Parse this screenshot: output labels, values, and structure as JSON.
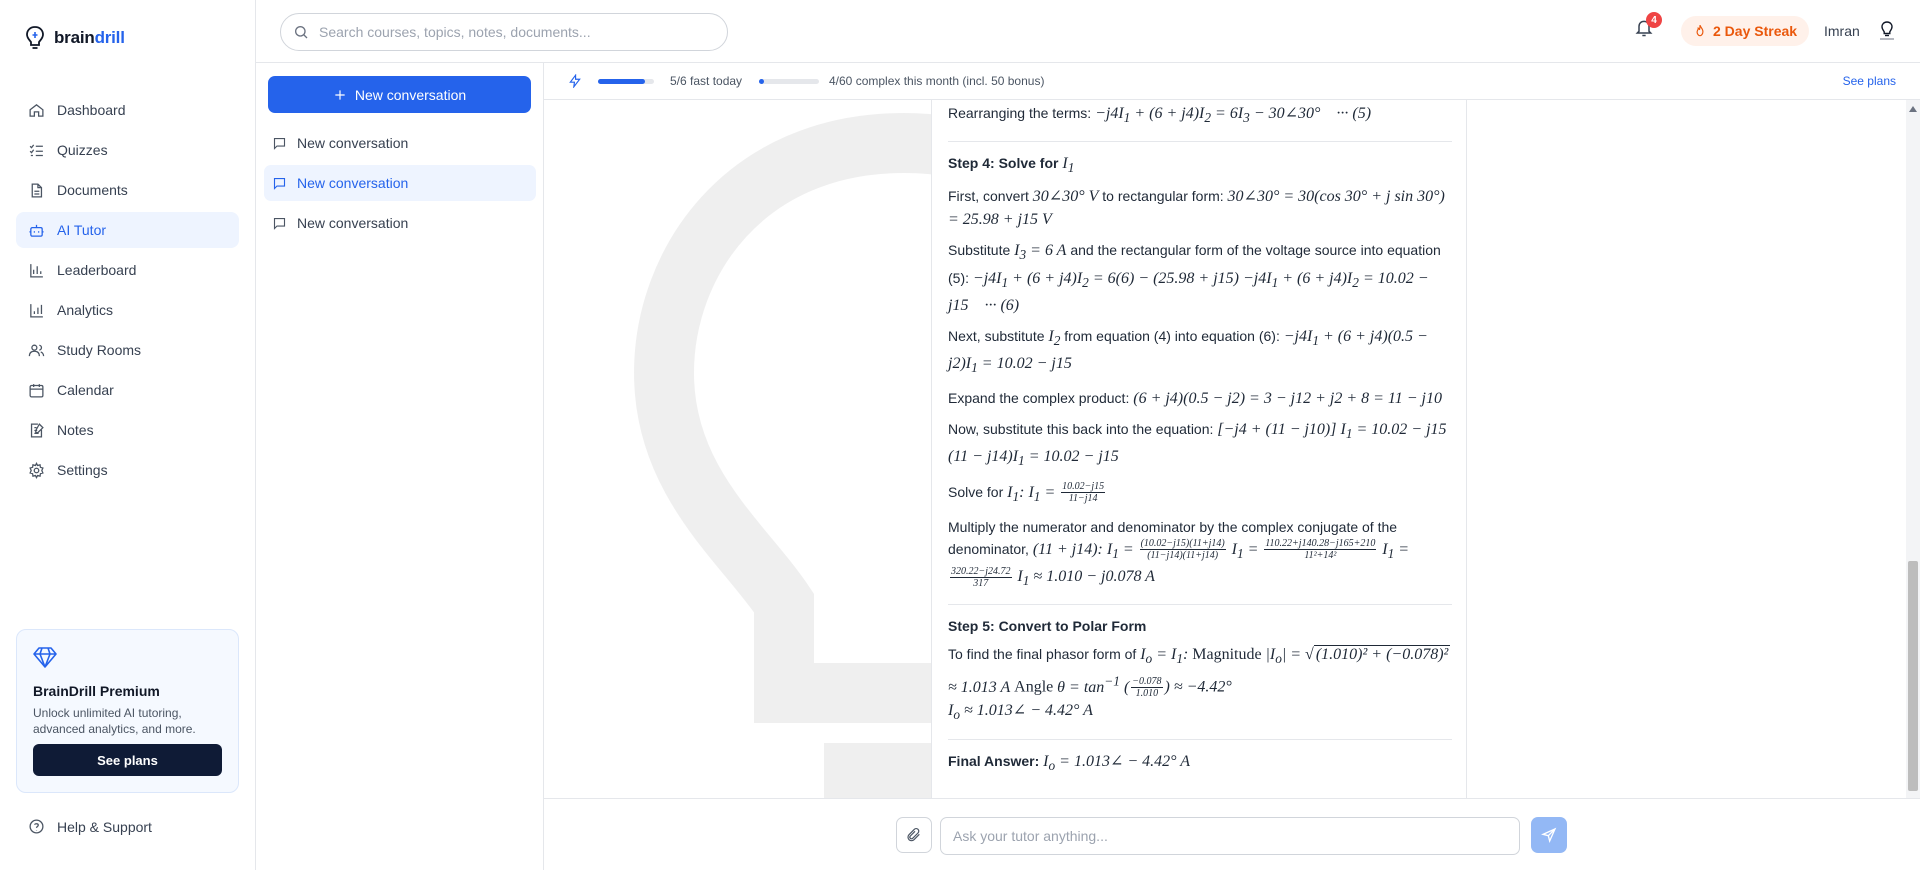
{
  "brand": {
    "name_part1": "brain",
    "name_part2": "drill"
  },
  "search": {
    "placeholder": "Search courses, topics, notes, documents..."
  },
  "header": {
    "notifications_count": "4",
    "streak_label": "2 Day Streak",
    "user_name": "Imran"
  },
  "sidebar": {
    "items": [
      {
        "label": "Dashboard",
        "icon": "home-icon"
      },
      {
        "label": "Quizzes",
        "icon": "list-check-icon"
      },
      {
        "label": "Documents",
        "icon": "document-icon"
      },
      {
        "label": "AI Tutor",
        "icon": "bot-icon",
        "active": true
      },
      {
        "label": "Leaderboard",
        "icon": "bar-chart-icon"
      },
      {
        "label": "Analytics",
        "icon": "analytics-icon"
      },
      {
        "label": "Study Rooms",
        "icon": "users-icon"
      },
      {
        "label": "Calendar",
        "icon": "calendar-icon"
      },
      {
        "label": "Notes",
        "icon": "notes-icon"
      },
      {
        "label": "Settings",
        "icon": "gear-icon"
      }
    ],
    "premium": {
      "title": "BrainDrill Premium",
      "description": "Unlock unlimited AI tutoring, advanced analytics, and more.",
      "button_label": "See plans"
    },
    "help_label": "Help & Support"
  },
  "conversations": {
    "new_button_label": "New conversation",
    "items": [
      {
        "label": "New conversation",
        "active": false
      },
      {
        "label": "New conversation",
        "active": true
      },
      {
        "label": "New conversation",
        "active": false
      }
    ]
  },
  "usage": {
    "fast_label": "5/6 fast today",
    "fast_fraction": 0.833,
    "complex_label": "4/60 complex this month (incl. 50 bonus)",
    "complex_fraction": 0.067,
    "see_plans_label": "See plans"
  },
  "message": {
    "rearrange_prefix": "Rearranging the terms:",
    "step4_title": "Step 4: Solve for",
    "step4_p1_prefix": "First, convert",
    "step4_p1_mid": "to rectangular form:",
    "step4_p2_prefix": "Substitute",
    "step4_p2_mid": "and the rectangular form of the voltage source into equation (5):",
    "step4_p3_prefix": "Next, substitute",
    "step4_p3_mid": "from equation (4) into equation (6):",
    "step4_p4_prefix": "Expand the complex product:",
    "step4_p5_prefix": "Now, substitute this back into the equation:",
    "step4_p6_prefix": "Solve for",
    "step4_p7_prefix": "Multiply the numerator and denominator by the complex conjugate of the denominator,",
    "step5_title": "Step 5: Convert to Polar Form",
    "step5_p1_prefix": "To find the final phasor form of",
    "step5_magnitude": "Magnitude",
    "step5_angle": "Angle",
    "final_label": "Final Answer:"
  },
  "composer": {
    "placeholder": "Ask your tutor anything..."
  },
  "colors": {
    "accent": "#2563eb",
    "streak": "#ea580c",
    "premium_button": "#0f1b36",
    "badge": "#ef4444"
  }
}
